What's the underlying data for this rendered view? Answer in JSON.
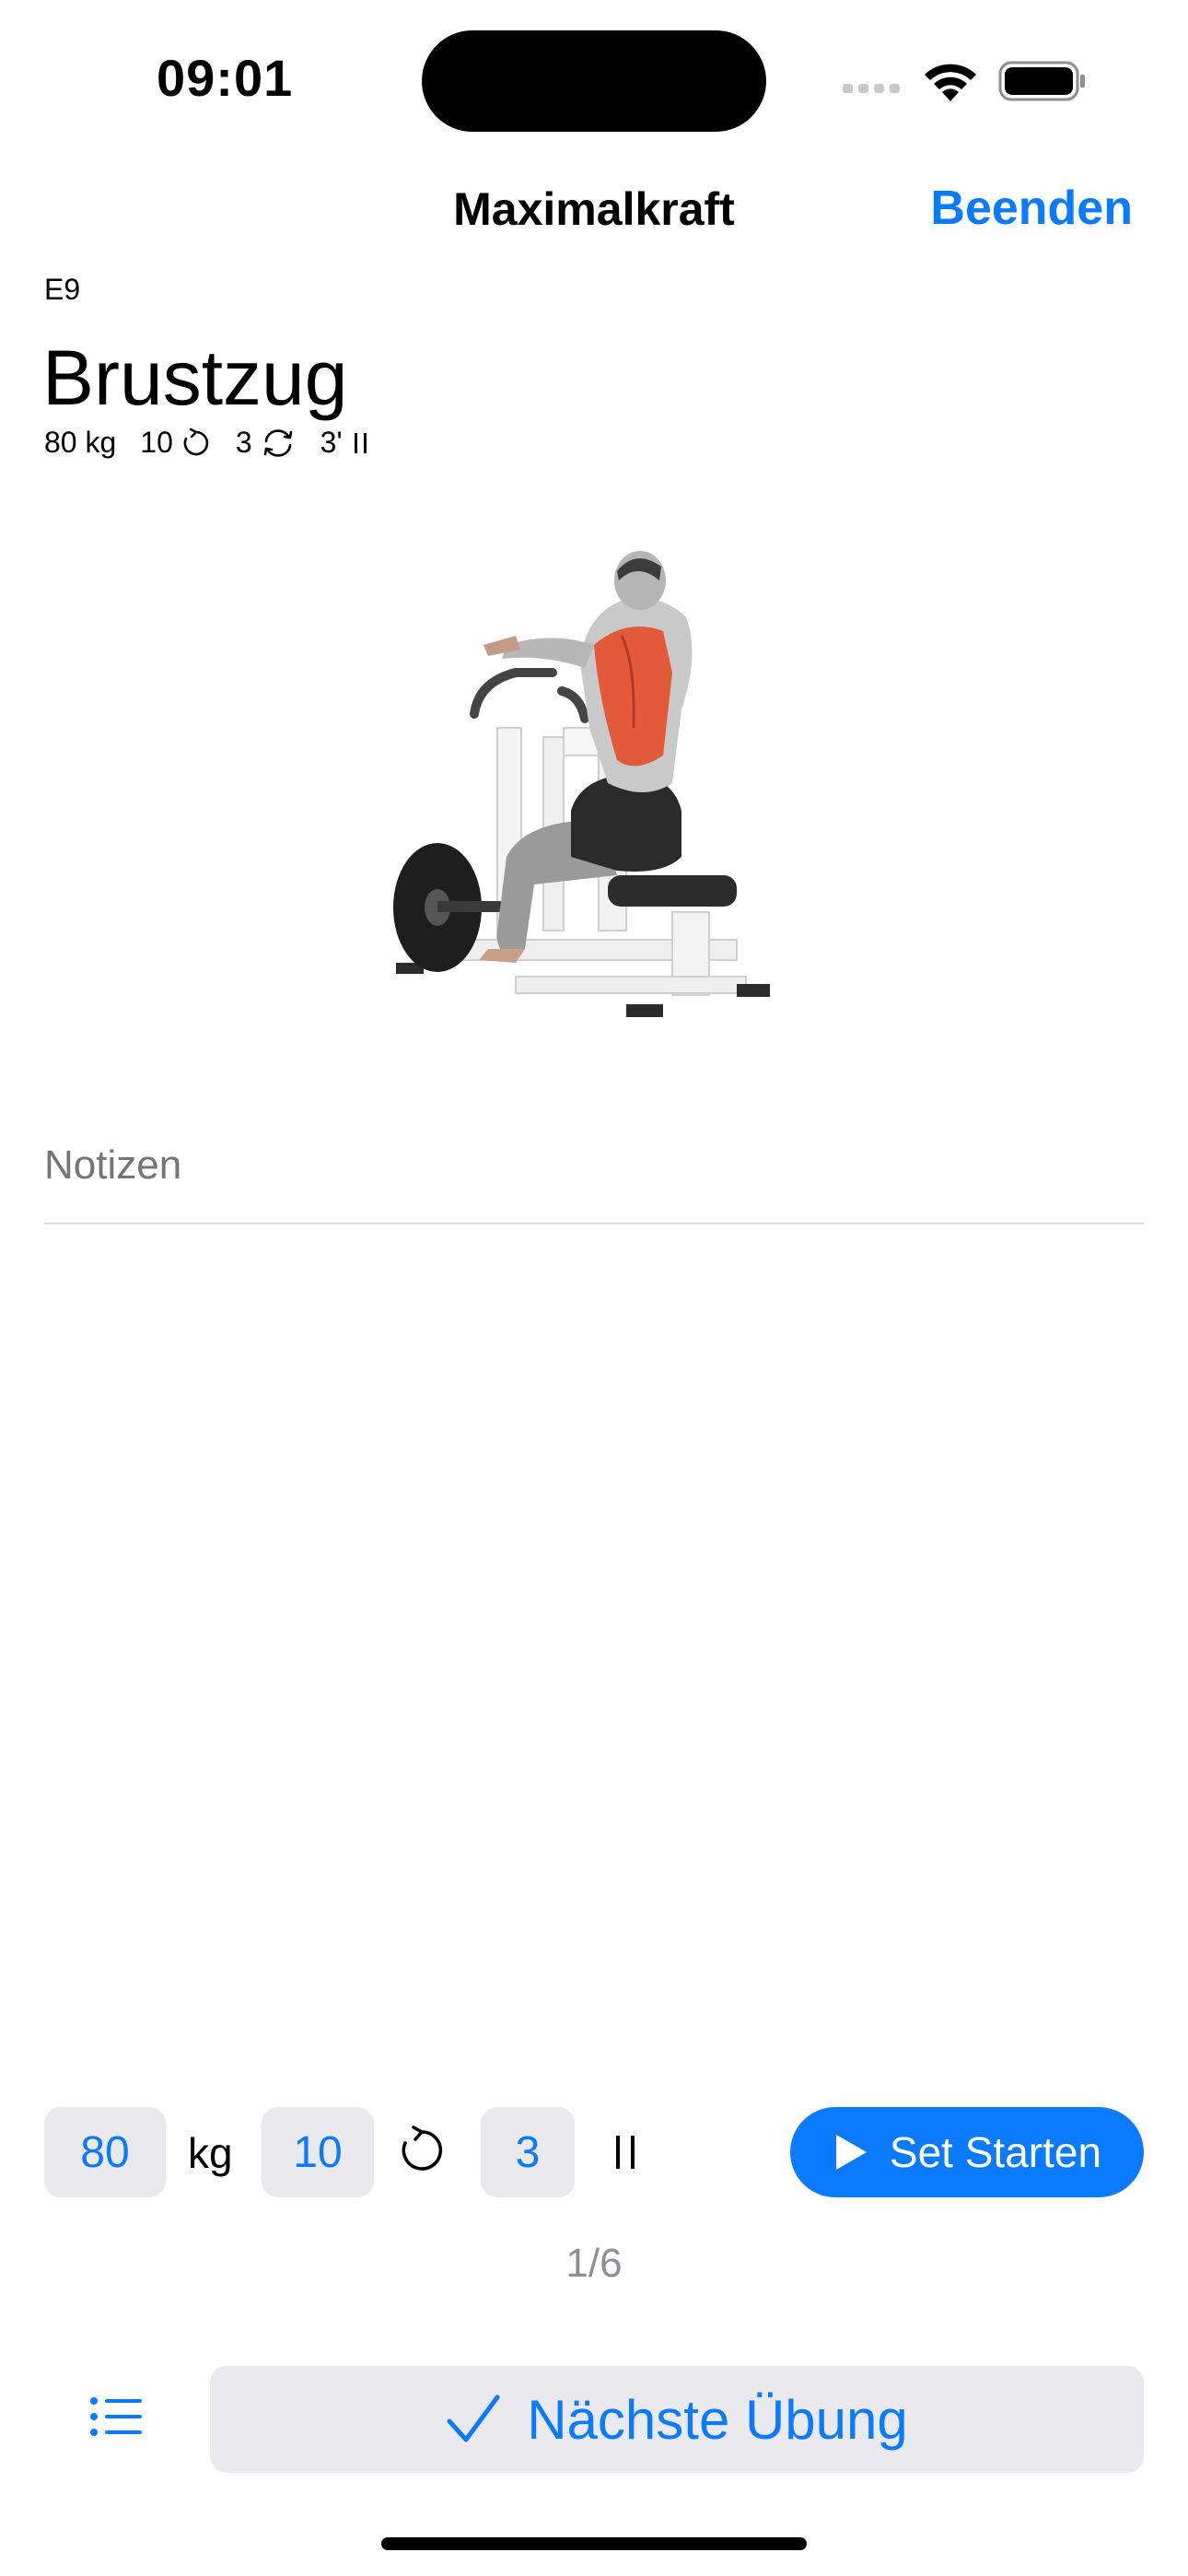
{
  "status_bar": {
    "time": "09:01"
  },
  "nav": {
    "title": "Maximalkraft",
    "end_label": "Beenden"
  },
  "exercise": {
    "code": "E9",
    "title": "Brustzug",
    "weight": "80 kg",
    "reps": "10",
    "sets": "3",
    "rest": "3'"
  },
  "notes": {
    "placeholder": "Notizen"
  },
  "controls": {
    "weight_value": "80",
    "weight_unit": "kg",
    "reps_value": "10",
    "sets_value": "3",
    "start_label": "Set Starten"
  },
  "progress": "1/6",
  "footer": {
    "next_label": "Nächste Übung"
  },
  "colors": {
    "accent": "#0a7aff",
    "field_bg": "#e9e9ee"
  }
}
